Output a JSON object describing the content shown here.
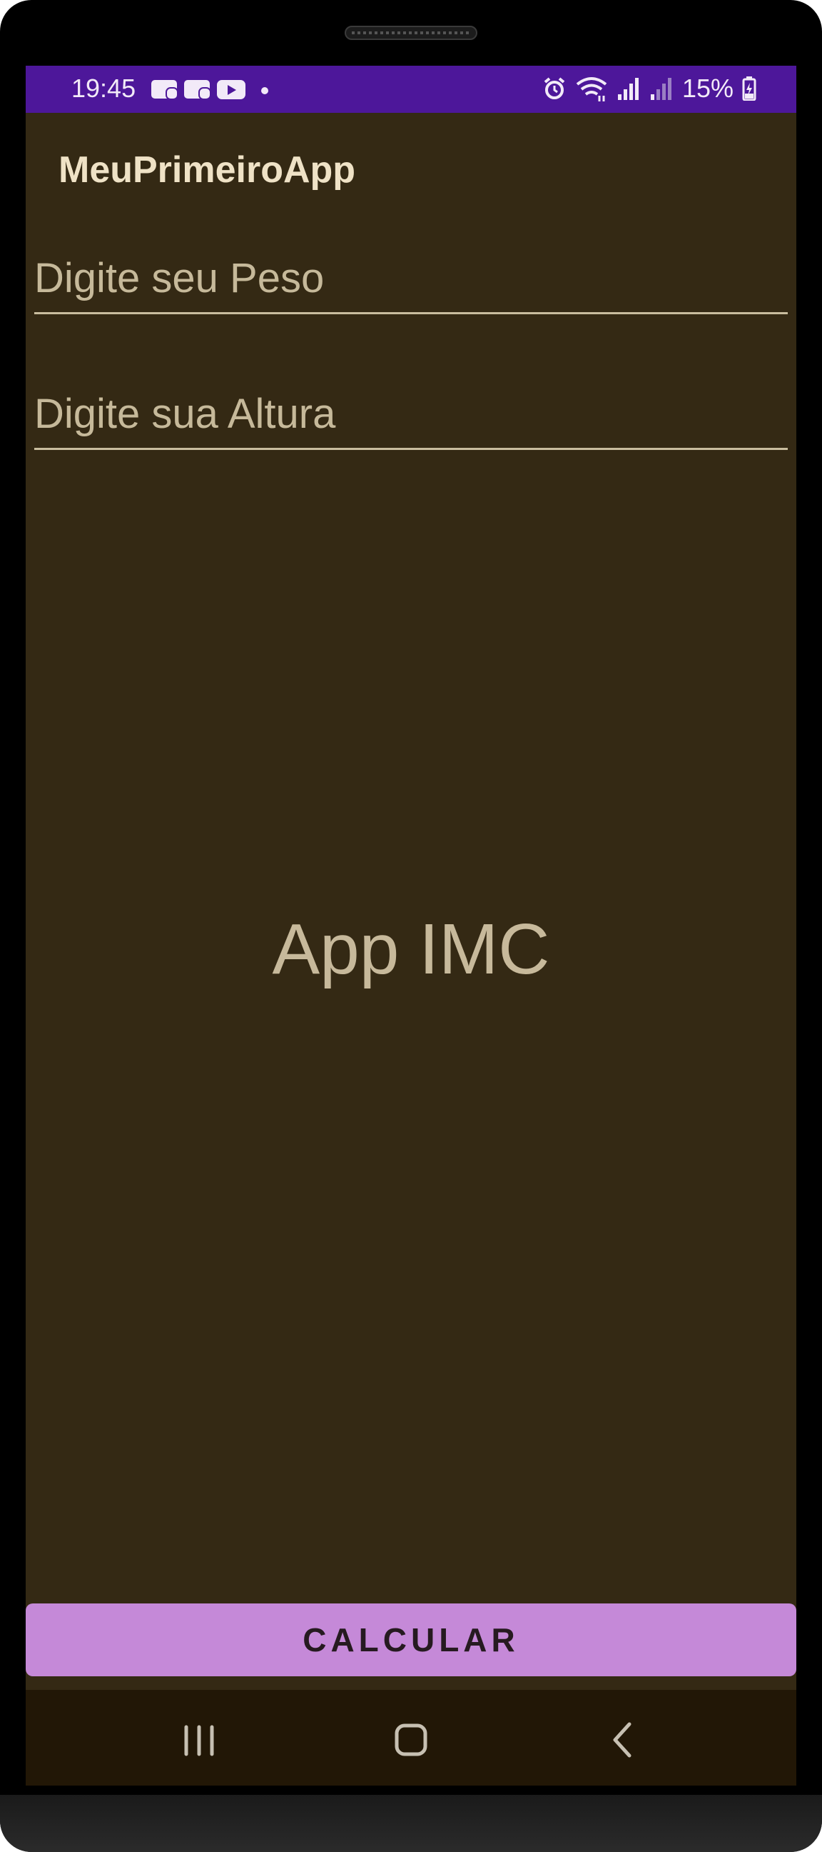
{
  "status_bar": {
    "time": "19:45",
    "battery_text": "15%",
    "icons": [
      "voicemail-1-icon",
      "voicemail-2-icon",
      "youtube-icon",
      "notification-dot-icon",
      "alarm-icon",
      "wifi-icon",
      "signal-sim1-icon",
      "signal-sim2-icon",
      "battery-charging-icon"
    ]
  },
  "app_bar": {
    "title": "MeuPrimeiroApp"
  },
  "form": {
    "peso": {
      "value": "",
      "placeholder": "Digite seu Peso"
    },
    "altura": {
      "value": "",
      "placeholder": "Digite sua Altura"
    }
  },
  "result": {
    "text": "App IMC"
  },
  "button": {
    "label": "CALCULAR"
  },
  "nav_bar": {
    "icons": [
      "recent-apps-icon",
      "home-icon",
      "back-icon"
    ]
  },
  "colors": {
    "status_bar": "#4d179a",
    "background": "#342914",
    "accent_button": "#c589d8",
    "nav_bar": "#221706",
    "text": "#c7b99b"
  }
}
